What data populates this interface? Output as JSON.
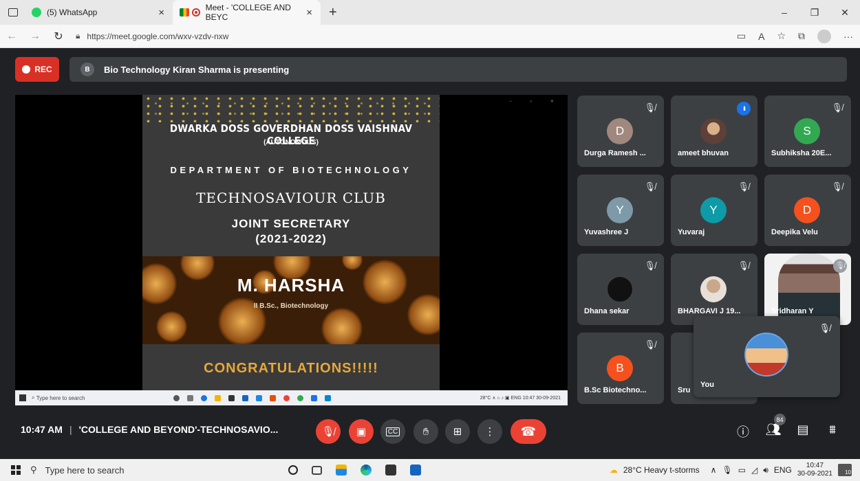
{
  "browser": {
    "tabs": [
      {
        "label": "(5) WhatsApp",
        "close": "×"
      },
      {
        "label": "Meet - 'COLLEGE AND BEYC",
        "close": "×"
      }
    ],
    "new_tab": "+",
    "url": "https://meet.google.com/wxv-vzdv-nxw",
    "window_controls": [
      "–",
      "❐",
      "✕"
    ]
  },
  "meet": {
    "rec_label": "REC",
    "presenter_initial": "B",
    "presenting_text": "Bio Technology Kiran Sharma is presenting",
    "time": "10:47 AM",
    "meeting_title": "'COLLEGE AND BEYOND'-TECHNOSAVIO...",
    "people_count": "84",
    "self_label": "You"
  },
  "slide": {
    "college": "DWARKA DOSS GOVERDHAN DOSS VAISHNAV COLLEGE",
    "autonomous": "(AUTONOMOUS)",
    "department": "DEPARTMENT OF BIOTECHNOLOGY",
    "club": "TECHNOSAVIOUR CLUB",
    "position": "JOINT SECRETARY",
    "year": "(2021-2022)",
    "name": "M. HARSHA",
    "degree": "II B.Sc., Biotechnology",
    "congrats": "CONGRATULATIONS!!!!!"
  },
  "mini_taskbar": {
    "search": "Type here to search",
    "tray": "28°C ∧ ⌂ ♪ ▣ ENG 10:47 30-09-2021"
  },
  "participants": [
    {
      "initial": "D",
      "name": "Durga Ramesh ...",
      "color": "#a1887f"
    },
    {
      "initial": "",
      "name": "ameet bhuvan",
      "color": "#795548"
    },
    {
      "initial": "S",
      "name": "Subhiksha 20E...",
      "color": "#33a852"
    },
    {
      "initial": "Y",
      "name": "Yuvashree J",
      "color": "#7e9aa8"
    },
    {
      "initial": "Y",
      "name": "Yuvaraj",
      "color": "#0e9aa7"
    },
    {
      "initial": "D",
      "name": "Deepika Velu",
      "color": "#f4511e"
    },
    {
      "initial": "",
      "name": "Dhana sekar",
      "color": "#111111"
    },
    {
      "initial": "",
      "name": "BHARGAVI J 19...",
      "color": "#c9a88a"
    },
    {
      "initial": "",
      "name": "Sridharan Y",
      "color": "#8d6e63"
    },
    {
      "initial": "B",
      "name": "B.Sc Biotechno...",
      "color": "#f4511e"
    },
    {
      "initial": "",
      "name": "Sru",
      "color": "#3c4043"
    }
  ],
  "taskbar": {
    "search": "Type here to search",
    "weather": "28°C  Heavy t-storms",
    "lang": "ENG",
    "time": "10:47",
    "date": "30-09-2021",
    "notifications": "10"
  }
}
